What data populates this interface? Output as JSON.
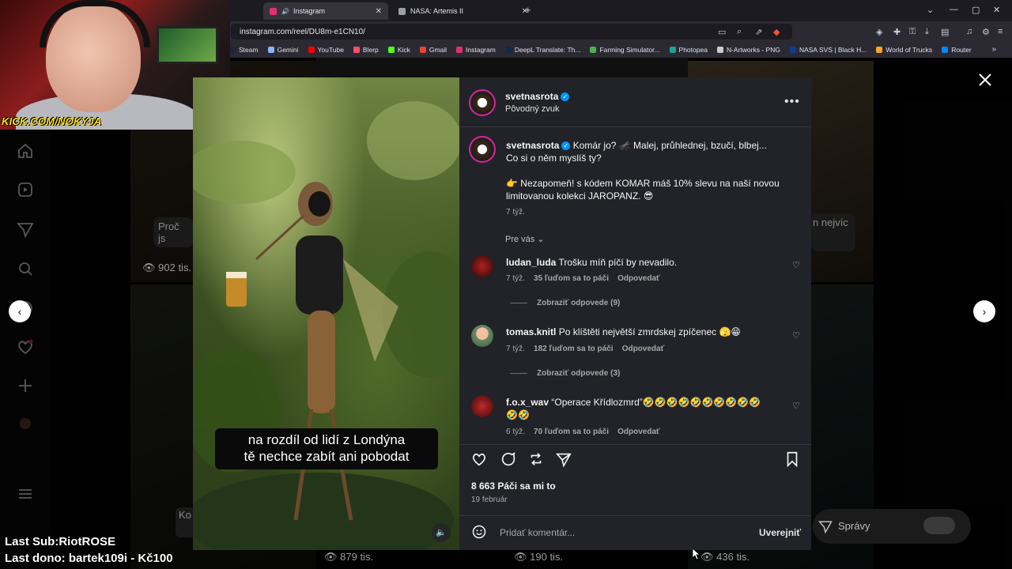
{
  "browser": {
    "tabs": [
      {
        "label": "Instagram",
        "active": true,
        "favicon_color": "#e1306c"
      },
      {
        "label": "NASA: Artemis II",
        "active": false,
        "favicon_color": "#9aa0a6"
      }
    ],
    "url": "instagram.com/reel/DU8m-e1CN10/",
    "bookmarks": [
      {
        "label": "Steam",
        "color": "#1b2838"
      },
      {
        "label": "Gemini",
        "color": "#8ab4f8"
      },
      {
        "label": "YouTube",
        "color": "#ff0000"
      },
      {
        "label": "Blerp",
        "color": "#ff4d6d"
      },
      {
        "label": "Kick",
        "color": "#53fc18"
      },
      {
        "label": "Gmail",
        "color": "#ea4335"
      },
      {
        "label": "Instagram",
        "color": "#e1306c"
      },
      {
        "label": "DeepL Translate: Th...",
        "color": "#0f2b46"
      },
      {
        "label": "Farming Simulator...",
        "color": "#4caf50"
      },
      {
        "label": "Photopea",
        "color": "#18a497"
      },
      {
        "label": "N-Artworks - PNG",
        "color": "#cccccc"
      },
      {
        "label": "NASA SVS | Black H...",
        "color": "#0b3d91"
      },
      {
        "label": "World of Trucks",
        "color": "#f5a623"
      },
      {
        "label": "Router",
        "color": "#0a84ff"
      }
    ]
  },
  "stream": {
    "cam_label": "KICK.COM/NOKYJA",
    "last_sub": "Last Sub:RiotROSE",
    "last_dono": "Last dono: bartek109i - Kč100"
  },
  "background": {
    "views": [
      "902 tis.",
      "879 tis.",
      "190 tis.",
      "436 tis."
    ],
    "tile_texts": [
      "Proč js",
      "n nejvíc",
      "Ko"
    ],
    "messages_label": "Správy"
  },
  "post": {
    "author": "svetnasrota",
    "audio": "Pôvodný zvuk",
    "caption_line1": "Komár jo? 🦟 Malej, průhlednej, bzučí, blbej...",
    "caption_line2": "Co si o něm myslíš ty?",
    "caption_line3": "👉 Nezapomeň! s kódem KOMAR máš 10% slevu na naší novou",
    "caption_line4": "limitovanou kolekci JAROPANZ. 😎",
    "caption_time": "7 týž.",
    "for_you": "Pre vás",
    "subtitle_line1": "na rozdíl od lidí z Londýna",
    "subtitle_line2": "tě nechce zabít ani pobodat",
    "likes": "8 663 Páči sa mi to",
    "date": "19 február",
    "comment_placeholder": "Pridať komentár...",
    "post_button": "Uverejniť"
  },
  "comments": [
    {
      "user": "ludan_luda",
      "text": "Trošku míň píčí by nevadilo.",
      "time": "7 týž.",
      "likes": "35 ľuďom sa to páči",
      "reply": "Odpovedať",
      "view_replies": "Zobraziť odpovede (9)"
    },
    {
      "user": "tomas.knitl",
      "text": "Po klíštěti největší zmrdskej zpíčenec 🫣😁",
      "time": "7 týž.",
      "likes": "182 ľuďom sa to páči",
      "reply": "Odpovedať",
      "view_replies": "Zobraziť odpovede (3)"
    },
    {
      "user": "f.o.x_wav",
      "text": "“Operace Křídlozmrd”🤣🤣🤣🤣🤣🤣🤣🤣🤣🤣",
      "text2": "🤣🤣",
      "time": "6 týž.",
      "likes": "70 ľuďom sa to páči",
      "reply": "Odpovedať"
    }
  ]
}
